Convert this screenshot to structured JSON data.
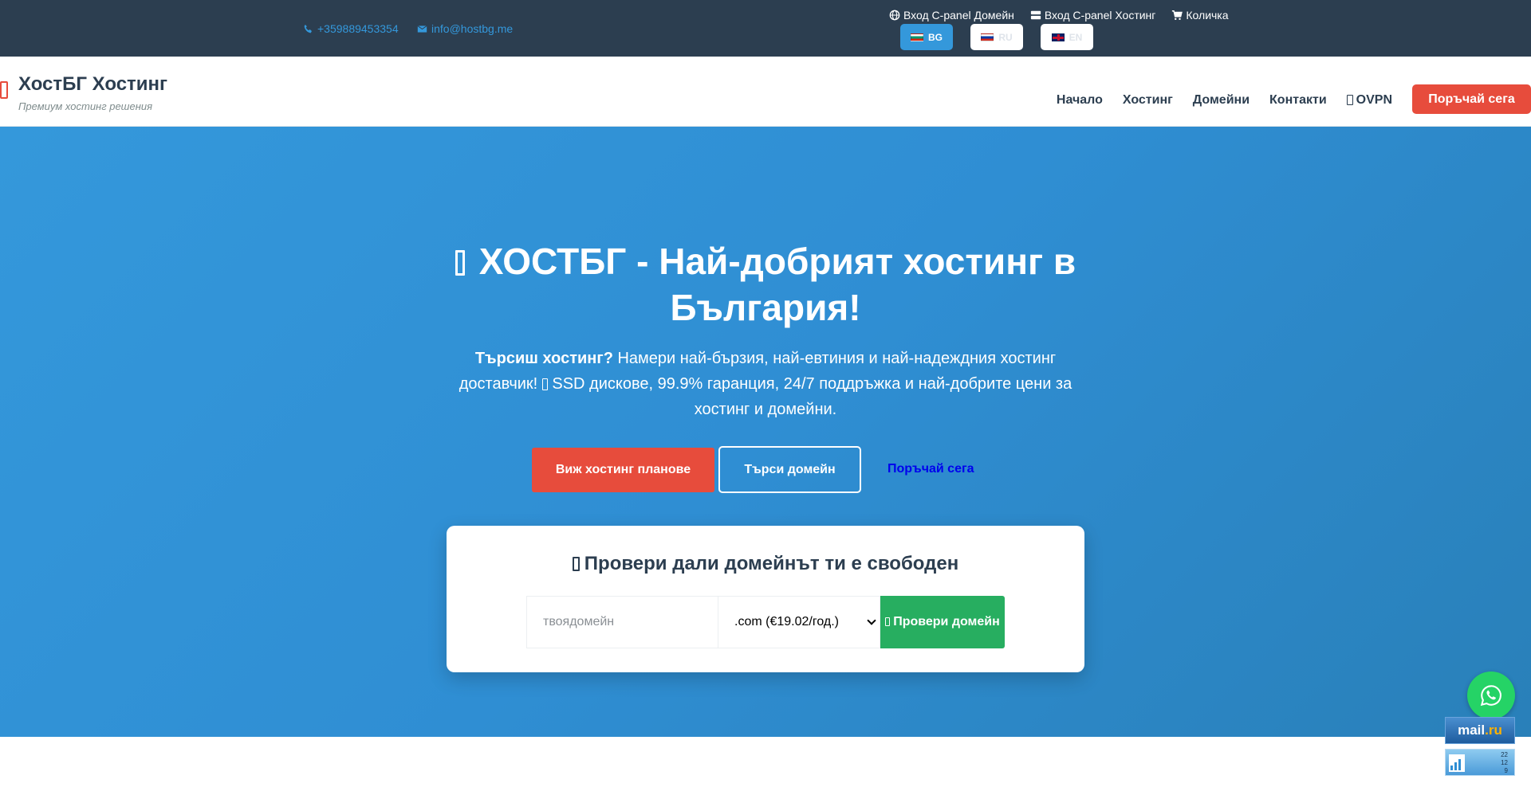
{
  "topbar": {
    "phone": "+359889453354",
    "email": "info@hostbg.me",
    "links": [
      "Вход C-panel Домейн",
      "Вход C-panel Хостинг",
      "Количка"
    ],
    "languages": [
      {
        "code": "BG",
        "flag": "bg-flag-icon",
        "active": true
      },
      {
        "code": "RU",
        "flag": "ru-flag-icon",
        "active": false
      },
      {
        "code": "EN",
        "flag": "en-flag-icon",
        "active": false
      }
    ]
  },
  "header": {
    "brand": "ХостБГ Хостинг",
    "tagline": "Премиум хостинг решения",
    "nav": [
      "Начало",
      "Хостинг",
      "Домейни",
      "Контакти",
      "OVPN"
    ],
    "order_button": "Поръчай сега"
  },
  "hero": {
    "title": "ХОСТБГ - Най-добрият хостинг в България!",
    "subtitle_bold": "Търсиш хостинг?",
    "subtitle_part1": " Намери най-бързия, най-евтиния и най-надеждния хостинг доставчик! ",
    "subtitle_part2": " SSD дискове, 99.9% гаранция, 24/7 поддръжка и най-добрите цени за хостинг и домейни.",
    "buttons": {
      "plans": "Виж хостинг планове",
      "search_domain": "Търси домейн",
      "order_link": "Поръчай сега"
    }
  },
  "domain_check": {
    "title": "Провери дали домейнът ти е свободен",
    "input_placeholder": "твоядомейн",
    "selected_tld": ".com (€19.02/год.)",
    "button": "Провери домейн"
  },
  "widgets": {
    "mailru_label": "mail",
    "mailru_suffix": ".ru",
    "counter_values": [
      "22",
      "12",
      "9"
    ]
  },
  "colors": {
    "topbar": "#2c3e50",
    "accent_blue": "#3498db",
    "accent_red": "#e74c3c",
    "accent_green": "#27ae60"
  }
}
